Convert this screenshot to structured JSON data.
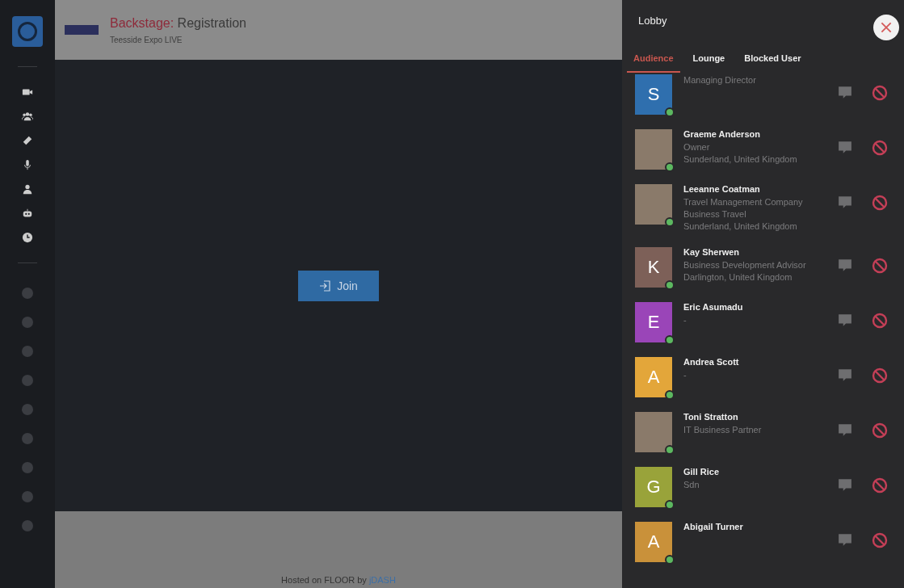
{
  "header": {
    "title_prefix": "Backstage:",
    "title": "Registration",
    "subtitle": "Teesside Expo LIVE"
  },
  "join_button": {
    "label": "Join"
  },
  "footer": {
    "text": "Hosted on FLOOR by",
    "link": "jDASH"
  },
  "panel": {
    "title": "Lobby",
    "tabs": [
      {
        "label": "Audience",
        "selected": true
      },
      {
        "label": "Lounge",
        "selected": false
      },
      {
        "label": "Blocked User",
        "selected": false
      }
    ],
    "members": [
      {
        "kind": "letter",
        "initial": "S",
        "color": "#2f6fae",
        "online": true,
        "lines": [
          "Managing Director"
        ]
      },
      {
        "kind": "photo",
        "name": "Graeme Anderson",
        "online": true,
        "lines": [
          "Owner",
          "Sunderland, United Kingdom"
        ]
      },
      {
        "kind": "photo",
        "name": "Leeanne Coatman",
        "online": true,
        "lines": [
          "Travel Management Company",
          "Business Travel",
          "Sunderland, United Kingdom"
        ]
      },
      {
        "kind": "letter",
        "initial": "K",
        "color": "#7d6058",
        "name": "Kay Sherwen",
        "online": true,
        "lines": [
          "Business Development Advisor",
          "Darlington, United Kingdom"
        ]
      },
      {
        "kind": "letter",
        "initial": "E",
        "color": "#9a45b8",
        "name": "Eric Asumadu",
        "online": true,
        "lines": [
          "-"
        ]
      },
      {
        "kind": "letter",
        "initial": "A",
        "color": "#e3a63a",
        "name": "Andrea Scott",
        "online": true,
        "lines": [
          "-"
        ]
      },
      {
        "kind": "photo",
        "name": "Toni Stratton",
        "online": true,
        "lines": [
          "IT Business Partner"
        ]
      },
      {
        "kind": "letter",
        "initial": "G",
        "color": "#99a33a",
        "name": "Gill Rice",
        "online": true,
        "lines": [
          "Sdn"
        ]
      },
      {
        "kind": "letter",
        "initial": "A",
        "color": "#c9913a",
        "name": "Abigail Turner",
        "online": true
      }
    ]
  }
}
